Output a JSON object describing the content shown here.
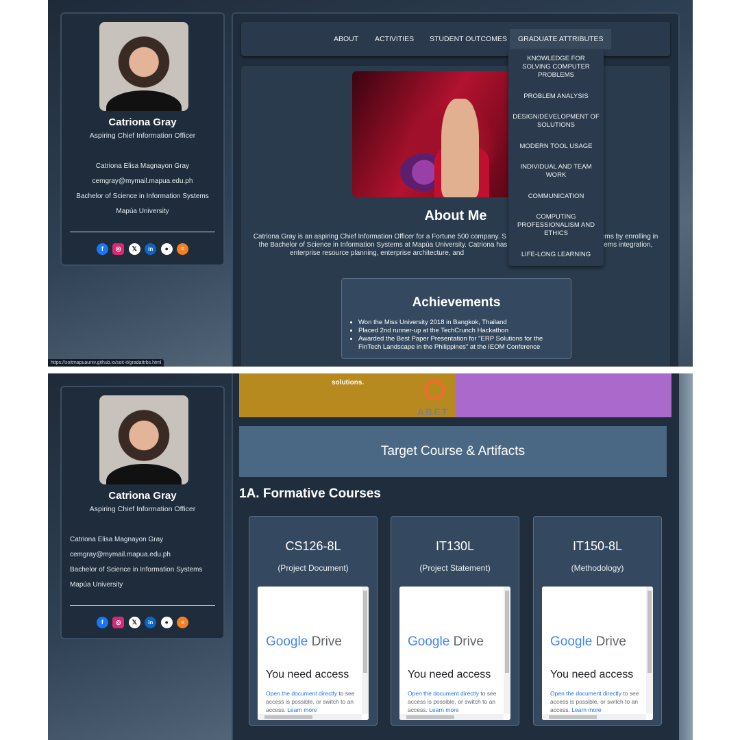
{
  "profile": {
    "name": "Catriona Gray",
    "title": "Aspiring Chief Information Officer",
    "full_name": "Catriona Elisa Magnayon Gray",
    "email": "cemgray@mymail.mapua.edu.ph",
    "degree": "Bachelor of Science in Information Systems",
    "school": "Mapúa University",
    "social_icons": [
      "facebook-icon",
      "instagram-icon",
      "x-icon",
      "linkedin-icon",
      "github-icon",
      "stackoverflow-icon"
    ]
  },
  "nav": {
    "about": "ABOUT",
    "activities": "ACTIVITIES",
    "student_outcomes": "STUDENT OUTCOMES",
    "graduate_attributes": "GRADUATE ATTRIBUTES"
  },
  "dropdown": [
    "KNOWLEDGE FOR SOLVING COMPUTER PROBLEMS",
    "PROBLEM ANALYSIS",
    "DESIGN/DEVELOPMENT OF SOLUTIONS",
    "MODERN TOOL USAGE",
    "INDIVIDUAL AND TEAM WORK",
    "COMMUNICATION",
    "COMPUTING PROFESSIONALISM AND ETHICS",
    "LIFE-LONG LEARNING"
  ],
  "about": {
    "title": "About Me",
    "line1": "Catriona Gray is an aspiring Chief Information Officer for a Fortune 500 company. S",
    "line1_tail": "ems by enrolling in",
    "line2": "the Bachelor of Science in Information Systems at Mapúa University. Catriona has",
    "line2_tail": "tems integration,",
    "line3": "enterprise resource planning, enterprise architecture, and"
  },
  "achievements": {
    "title": "Achievements",
    "items": [
      "Won the Miss University 2018 in Bangkok, Thailand",
      "Placed 2nd runner-up at the TechCrunch Hackathon",
      "Awarded the Best Paper Presentation for \"ERP Solutions for the FinTech Landscape in the Philippines\" at the IEOM Conference"
    ]
  },
  "status_url": "https://soitmapuauniv.github.io/soit-it/gradattrbs.html",
  "band": {
    "solutions": "solutions.",
    "abet": "ABET"
  },
  "target_heading": "Target Course & Artifacts",
  "formative_heading": "1A. Formative Courses",
  "courses": [
    {
      "code": "CS126-8L",
      "artifact": "(Project Document)"
    },
    {
      "code": "IT130L",
      "artifact": "(Project Statement)"
    },
    {
      "code": "IT150-8L",
      "artifact": "(Methodology)"
    }
  ],
  "gdrive": {
    "google": "Google",
    "drive": "Drive",
    "need_access": "You need access",
    "open_link": "Open the document directly",
    "rest1": " to see",
    "rest2": "access is possible, or switch to an",
    "rest3": "access. ",
    "learn_more": "Learn more"
  },
  "colors": {
    "facebook": "#1877f2",
    "instagram": "#d62976",
    "x": "#111111",
    "linkedin": "#0a66c2",
    "github": "#222222",
    "stackoverflow": "#f48024",
    "google_blue": "#4285f4",
    "google_red": "#ea4335",
    "google_yellow": "#fbbc05",
    "google_green": "#34a853"
  }
}
